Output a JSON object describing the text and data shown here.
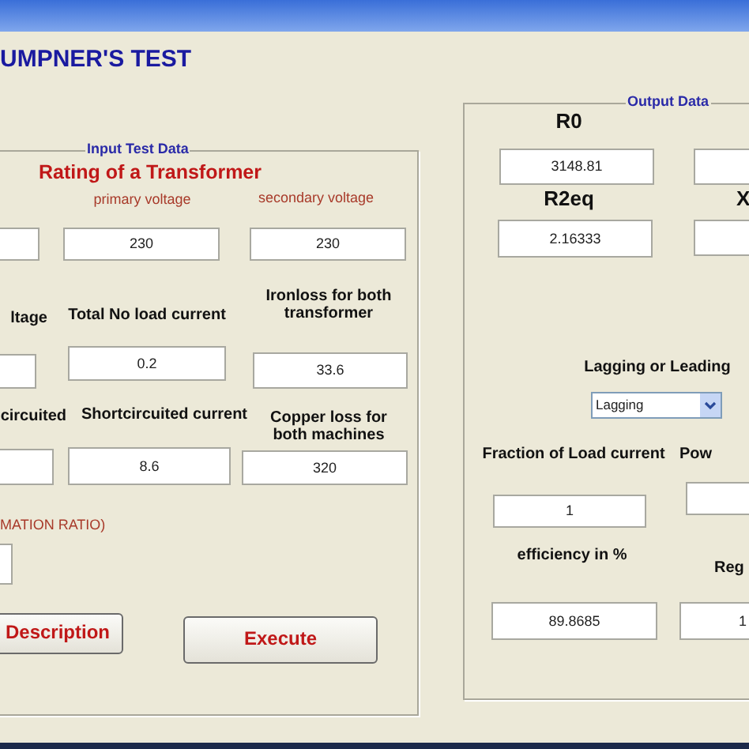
{
  "window": {
    "heading": "UMPNER'S TEST"
  },
  "input_panel": {
    "legend": "Input Test Data",
    "items": [
      {
        "kind": "title",
        "text": "Rating of a Transformer"
      },
      {
        "kind": "caption",
        "text": "primary voltage"
      },
      {
        "kind": "caption",
        "text": "secondary voltage"
      },
      {
        "kind": "field"
      },
      {
        "kind": "field",
        "text": "230"
      },
      {
        "kind": "field",
        "text": "230"
      },
      {
        "kind": "label",
        "text": "ltage"
      },
      {
        "kind": "label",
        "text": "Total No load current"
      },
      {
        "kind": "label",
        "text": "Ironloss for both transformer"
      },
      {
        "kind": "field"
      },
      {
        "kind": "field",
        "text": "0.2"
      },
      {
        "kind": "field",
        "text": "33.6"
      },
      {
        "kind": "label",
        "text": "circuited"
      },
      {
        "kind": "label",
        "text": "Shortcircuited current"
      },
      {
        "kind": "label",
        "text": "Copper loss for both machines"
      },
      {
        "kind": "field"
      },
      {
        "kind": "field",
        "text": "8.6"
      },
      {
        "kind": "field",
        "text": "320"
      },
      {
        "kind": "caption",
        "text": "MATION RATIO)"
      },
      {
        "kind": "field"
      },
      {
        "kind": "button",
        "text": "Description"
      },
      {
        "kind": "button",
        "text": "Execute"
      }
    ]
  },
  "output_panel": {
    "legend": "Output Data",
    "items": [
      {
        "kind": "heading",
        "text": "R0"
      },
      {
        "kind": "field",
        "text": "3148.81"
      },
      {
        "kind": "field"
      },
      {
        "kind": "heading",
        "text": "R2eq"
      },
      {
        "kind": "heading",
        "text": "X"
      },
      {
        "kind": "field",
        "text": "2.16333"
      },
      {
        "kind": "field"
      },
      {
        "kind": "label",
        "text": "Lagging or Leading"
      },
      {
        "kind": "dropdown",
        "text": "Lagging"
      },
      {
        "kind": "label",
        "text": "Fraction of Load current"
      },
      {
        "kind": "label",
        "text": "Pow"
      },
      {
        "kind": "field",
        "text": "1"
      },
      {
        "kind": "field"
      },
      {
        "kind": "label",
        "text": "efficiency in %"
      },
      {
        "kind": "label",
        "text": "Reg"
      },
      {
        "kind": "field",
        "text": "89.8685"
      },
      {
        "kind": "field",
        "text": "1"
      }
    ]
  }
}
